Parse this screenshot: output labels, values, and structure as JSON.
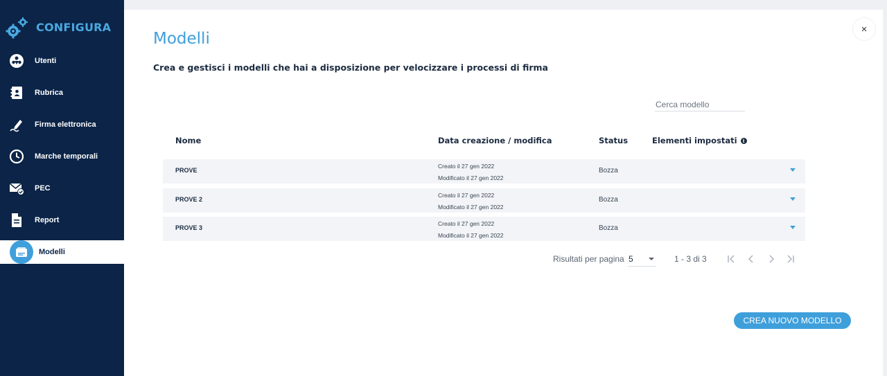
{
  "sidebar": {
    "brand": "CONFIGURA",
    "items": [
      {
        "label": "Utenti",
        "icon": "users-icon"
      },
      {
        "label": "Rubrica",
        "icon": "address-book-icon"
      },
      {
        "label": "Firma elettronica",
        "icon": "signature-pen-icon"
      },
      {
        "label": "Marche temporali",
        "icon": "clock-icon"
      },
      {
        "label": "PEC",
        "icon": "certified-mail-icon"
      },
      {
        "label": "Report",
        "icon": "document-icon"
      },
      {
        "label": "Modelli",
        "icon": "templates-icon",
        "active": true
      }
    ]
  },
  "main": {
    "title": "Modelli",
    "subtitle": "Crea e gestisci i modelli che hai a disposizione per velocizzare i processi di firma",
    "search_placeholder": "Cerca modello",
    "close_label": "×",
    "columns": {
      "name": "Nome",
      "date": "Data creazione / modifica",
      "status": "Status",
      "elements": "Elementi impostati"
    },
    "rows": [
      {
        "name": "PROVE",
        "created": "Creato il 27 gen 2022",
        "modified": "Modificato il 27 gen 2022",
        "status": "Bozza"
      },
      {
        "name": "PROVE 2",
        "created": "Creato il 27 gen 2022",
        "modified": "Modificato il 27 gen 2022",
        "status": "Bozza"
      },
      {
        "name": "PROVE 3",
        "created": "Creato il 27 gen 2022",
        "modified": "Modificato il 27 gen 2022",
        "status": "Bozza"
      }
    ],
    "pagination": {
      "per_page_label": "Risultati per pagina",
      "per_page_value": "5",
      "range": "1 - 3 di 3"
    },
    "create_button": "CREA NUOVO MODELLO"
  },
  "colors": {
    "sidebar_bg": "#0b2447",
    "accent": "#3f9fdb",
    "row_bg": "#f2f4f7"
  }
}
